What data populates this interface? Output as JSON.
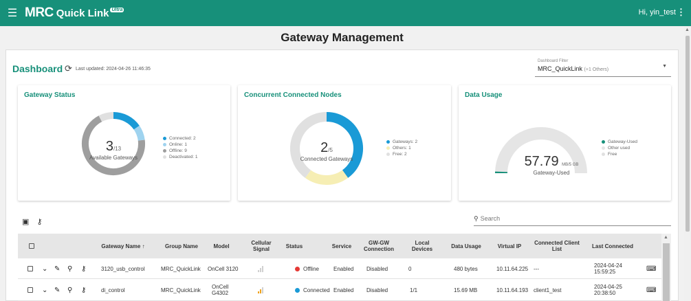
{
  "app": {
    "brand_main": "MRC",
    "brand_sub": "Quick Link",
    "brand_tag": "Ultra",
    "user": "Hi, yin_test"
  },
  "page": {
    "title": "Gateway Management"
  },
  "dashboard": {
    "title": "Dashboard",
    "last_updated": "Last updated: 2024-04-26 11:46:35",
    "filter_label": "Dashboard Filter",
    "filter_value": "MRC_QuickLink",
    "filter_extra": "(+1 Others)"
  },
  "gateway_status": {
    "title": "Gateway Status",
    "value": "3",
    "total": "/13",
    "caption": "Available Gateways",
    "legend": [
      {
        "label": "Connected: 2",
        "value": 2,
        "color": "#1a9ad6"
      },
      {
        "label": "Online: 1",
        "value": 1,
        "color": "#9fd3ef"
      },
      {
        "label": "Offline: 9",
        "value": 9,
        "color": "#9e9e9e"
      },
      {
        "label": "Deactivated: 1",
        "value": 1,
        "color": "#e0e0e0"
      }
    ]
  },
  "nodes": {
    "title": "Concurrent Connected Nodes",
    "value": "2",
    "total": "/5",
    "caption": "Connected Gateways",
    "legend": [
      {
        "label": "Gateways: 2",
        "value": 2,
        "color": "#1a9ad6"
      },
      {
        "label": "Others: 1",
        "value": 1,
        "color": "#f6eeb4"
      },
      {
        "label": "Free: 2",
        "value": 2,
        "color": "#e0e0e0"
      }
    ]
  },
  "data_usage": {
    "title": "Data Usage",
    "value": "57.79",
    "unit": "MB/5 GB",
    "caption": "Gateway-Used",
    "used_fraction": 0.011,
    "legend": [
      {
        "label": "Gateway-Used",
        "color": "#17907a"
      },
      {
        "label": "Other used",
        "color": "#e5e5e5"
      },
      {
        "label": "Free",
        "color": "#e0e0e0"
      }
    ]
  },
  "search": {
    "placeholder": "Search"
  },
  "table": {
    "headers": [
      "Gateway Name ↑",
      "Group Name",
      "Model",
      "Cellular Signal",
      "Status",
      "Service",
      "GW-GW Connection",
      "Local Devices",
      "Data Usage",
      "Virtual IP",
      "Connected Client List",
      "Last Connected"
    ],
    "rows": [
      {
        "name": "3120_usb_control",
        "group": "MRC_QuickLink",
        "model": "OnCell 3120",
        "status": "Offline",
        "status_color": "#e53935",
        "signal_bars": 0,
        "service": "Enabled",
        "gwgw": "Disabled",
        "local": "0",
        "usage": "480 bytes",
        "vip": "10.11.64.225",
        "clients": "---",
        "last": "2024-04-24 15:59:25"
      },
      {
        "name": "di_control",
        "group": "MRC_QuickLink",
        "model": "OnCell G4302",
        "status": "Connected",
        "status_color": "#1a9ad6",
        "signal_bars": 2,
        "service": "Enabled",
        "gwgw": "Disabled",
        "local": "1/1",
        "usage": "15.69 MB",
        "vip": "10.11.64.193",
        "clients": "client1_test",
        "last": "2024-04-25 20:38:50"
      }
    ]
  }
}
